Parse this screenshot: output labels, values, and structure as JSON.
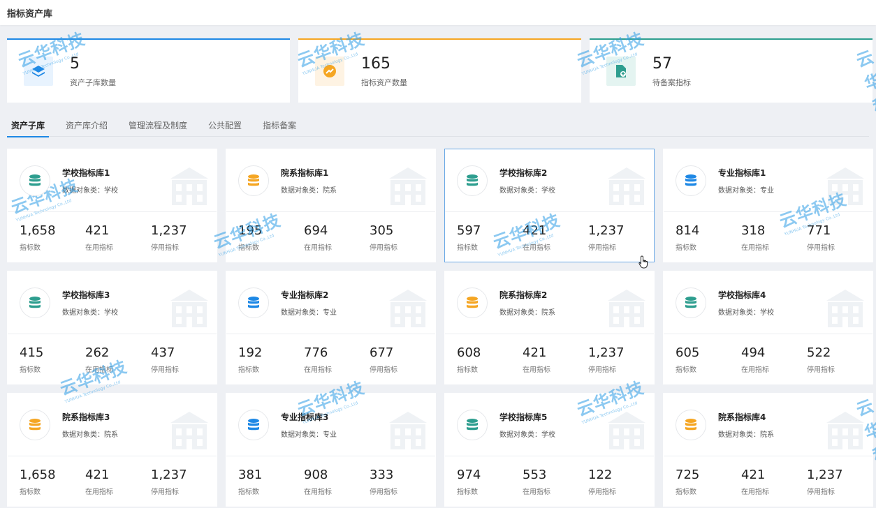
{
  "header": {
    "title": "指标资产库"
  },
  "stats": [
    {
      "value": "5",
      "label": "资产子库数量"
    },
    {
      "value": "165",
      "label": "指标资产数量"
    },
    {
      "value": "57",
      "label": "待备案指标"
    }
  ],
  "tabs": [
    "资产子库",
    "资产库介绍",
    "管理流程及制度",
    "公共配置",
    "指标备案"
  ],
  "metric_labels": {
    "total": "指标数",
    "active": "在用指标",
    "inactive": "停用指标"
  },
  "libraries": [
    {
      "name": "学校指标库1",
      "object": "数据对象类：学校",
      "color": "#2e9e8f",
      "total": "1,658",
      "active": "421",
      "inactive": "1,237"
    },
    {
      "name": "院系指标库1",
      "object": "数据对象类：院系",
      "color": "#f5a623",
      "total": "195",
      "active": "694",
      "inactive": "305"
    },
    {
      "name": "学校指标库2",
      "object": "数据对象类：学校",
      "color": "#2e9e8f",
      "total": "597",
      "active": "421",
      "inactive": "1,237"
    },
    {
      "name": "专业指标库1",
      "object": "数据对象类：专业",
      "color": "#1e88e5",
      "total": "814",
      "active": "318",
      "inactive": "771"
    },
    {
      "name": "学校指标库3",
      "object": "数据对象类：学校",
      "color": "#2e9e8f",
      "total": "415",
      "active": "262",
      "inactive": "437"
    },
    {
      "name": "专业指标库2",
      "object": "数据对象类：专业",
      "color": "#1e88e5",
      "total": "192",
      "active": "776",
      "inactive": "677"
    },
    {
      "name": "院系指标库2",
      "object": "数据对象类：院系",
      "color": "#f5a623",
      "total": "608",
      "active": "421",
      "inactive": "1,237"
    },
    {
      "name": "学校指标库4",
      "object": "数据对象类：学校",
      "color": "#2e9e8f",
      "total": "605",
      "active": "494",
      "inactive": "522"
    },
    {
      "name": "院系指标库3",
      "object": "数据对象类：院系",
      "color": "#f5a623",
      "total": "1,658",
      "active": "421",
      "inactive": "1,237"
    },
    {
      "name": "专业指标库3",
      "object": "数据对象类：专业",
      "color": "#1e88e5",
      "total": "381",
      "active": "908",
      "inactive": "333"
    },
    {
      "name": "学校指标库5",
      "object": "数据对象类：学校",
      "color": "#2e9e8f",
      "total": "974",
      "active": "553",
      "inactive": "122"
    },
    {
      "name": "院系指标库4",
      "object": "数据对象类：院系",
      "color": "#f5a623",
      "total": "725",
      "active": "421",
      "inactive": "1,237"
    }
  ],
  "watermark": {
    "text": "云华科技",
    "sub": "YUNHUA Technology Co.,Ltd"
  }
}
